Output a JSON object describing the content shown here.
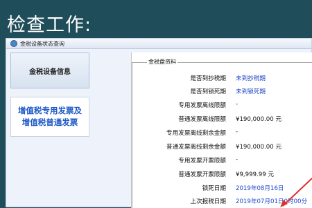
{
  "page_title": "检查工作:",
  "window_title": "金税设备状态查询",
  "sidebar": {
    "items": [
      {
        "label": "金税设备信息"
      },
      {
        "label": "增值税专用发票及增值税普通发票"
      }
    ]
  },
  "panel": {
    "group_title": "金税盘资料",
    "rows": [
      {
        "label": "是否到抄税期",
        "value": "未到抄税期"
      },
      {
        "label": "是否到锁死期",
        "value": "未到锁死期"
      },
      {
        "label": "专用发票离线限额",
        "value": "-"
      },
      {
        "label": "普通发票离线限额",
        "value": "¥190,000.00 元"
      },
      {
        "label": "专用发票离线剩余金额",
        "value": "-"
      },
      {
        "label": "普通发票离线剩余金额",
        "value": "¥190,000.00 元"
      },
      {
        "label": "专用发票开票限额",
        "value": "-"
      },
      {
        "label": "普通发票开票限额",
        "value": "¥9,999.99 元"
      },
      {
        "label": "锁死日期",
        "value": "2019年08月16日"
      },
      {
        "label": "上次报税日期",
        "value": "2019年07月01日0时00分"
      }
    ]
  },
  "colors": {
    "background": "#1f4d5a",
    "accent_blue": "#1b57c7",
    "arrow_red": "#e0302a"
  }
}
